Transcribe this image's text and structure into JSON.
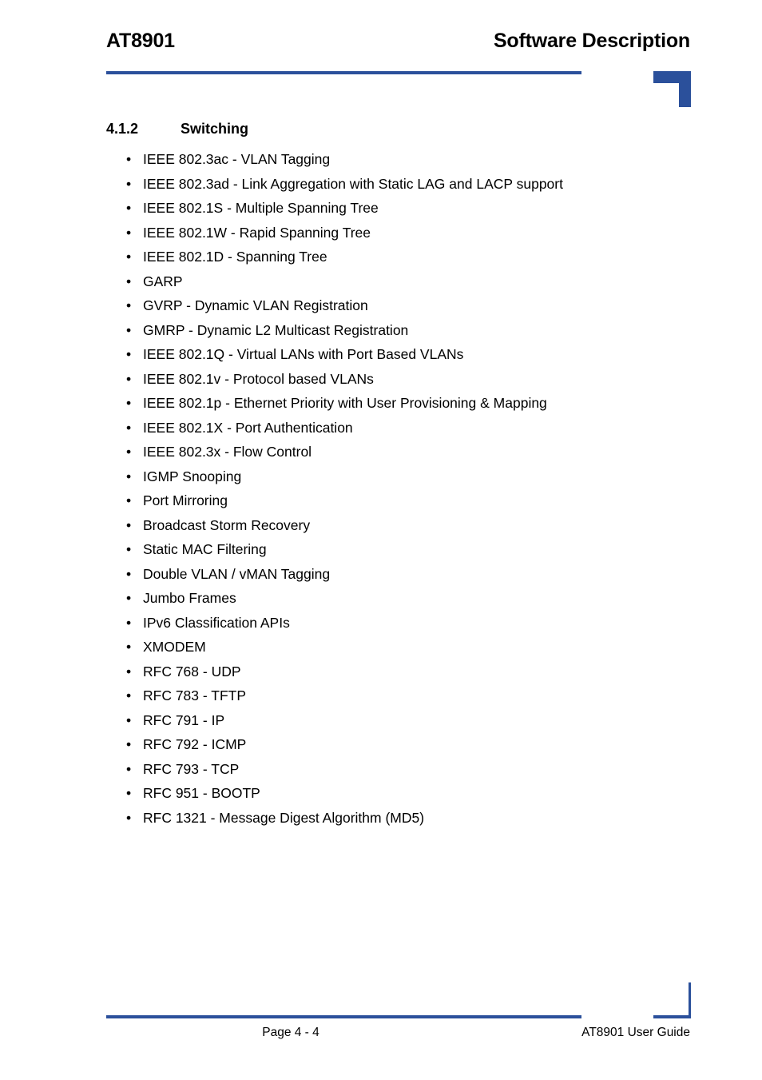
{
  "document": {
    "header": {
      "title_left": "AT8901",
      "title_right": "Software Description"
    },
    "section": {
      "number": "4.1.2",
      "title": "Switching"
    },
    "bullets": [
      "IEEE 802.3ac - VLAN Tagging",
      "IEEE 802.3ad - Link Aggregation with Static LAG and LACP support",
      "IEEE 802.1S - Multiple Spanning Tree",
      "IEEE 802.1W - Rapid Spanning Tree",
      "IEEE 802.1D - Spanning Tree",
      "GARP",
      "GVRP - Dynamic VLAN Registration",
      "GMRP - Dynamic L2 Multicast Registration",
      "IEEE 802.1Q - Virtual LANs with Port Based VLANs",
      "IEEE 802.1v - Protocol based VLANs",
      "IEEE 802.1p - Ethernet Priority with User Provisioning & Mapping",
      "IEEE 802.1X - Port Authentication",
      "IEEE 802.3x - Flow Control",
      "IGMP Snooping",
      "Port Mirroring",
      "Broadcast Storm Recovery",
      "Static MAC Filtering",
      "Double VLAN / vMAN Tagging",
      "Jumbo Frames",
      "IPv6 Classification APIs",
      "XMODEM",
      "RFC 768 - UDP",
      "RFC 783 - TFTP",
      "RFC 791 - IP",
      "RFC 792 - ICMP",
      "RFC 793 - TCP",
      "RFC 951 - BOOTP",
      "RFC 1321 - Message Digest Algorithm (MD5)"
    ],
    "bullet_marker": "•",
    "footer": {
      "page_label": "Page 4 - 4",
      "guide_label": "AT8901 User Guide"
    },
    "colors": {
      "accent_blue": "#2b509b",
      "text": "#000000",
      "background": "#ffffff"
    }
  }
}
